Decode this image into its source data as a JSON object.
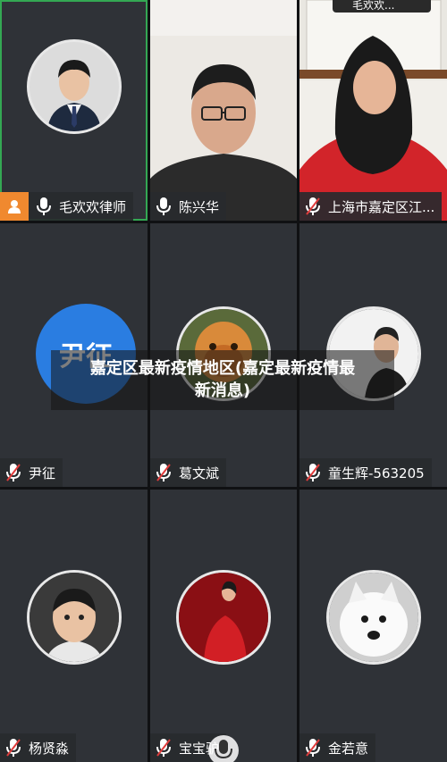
{
  "overlay": {
    "title_line1": "嘉定区最新疫情地区(嘉定最新疫情最",
    "title_line2": "新消息)"
  },
  "top_chip": {
    "text": "毛欢欢..."
  },
  "participants": [
    {
      "name": "毛欢欢律师",
      "mic": "on",
      "host": true
    },
    {
      "name": "陈兴华",
      "mic": "on",
      "host": false
    },
    {
      "name": "上海市嘉定区江...",
      "mic": "muted",
      "host": false
    },
    {
      "name": "尹征",
      "mic": "muted",
      "host": false,
      "avatar_text": "尹征"
    },
    {
      "name": "葛文斌",
      "mic": "muted",
      "host": false
    },
    {
      "name": "童生辉-563205",
      "mic": "muted",
      "host": false
    },
    {
      "name": "杨贤淼",
      "mic": "muted",
      "host": false
    },
    {
      "name": "宝宝驴",
      "mic": "muted",
      "host": false
    },
    {
      "name": "金若意",
      "mic": "muted",
      "host": false
    }
  ],
  "colors": {
    "tile_bg": "#2f3237",
    "active_border": "#34a853",
    "host_badge": "#f0892f",
    "muted_mic": "#e03c3c",
    "avatar_blue": "#2a7de1"
  }
}
